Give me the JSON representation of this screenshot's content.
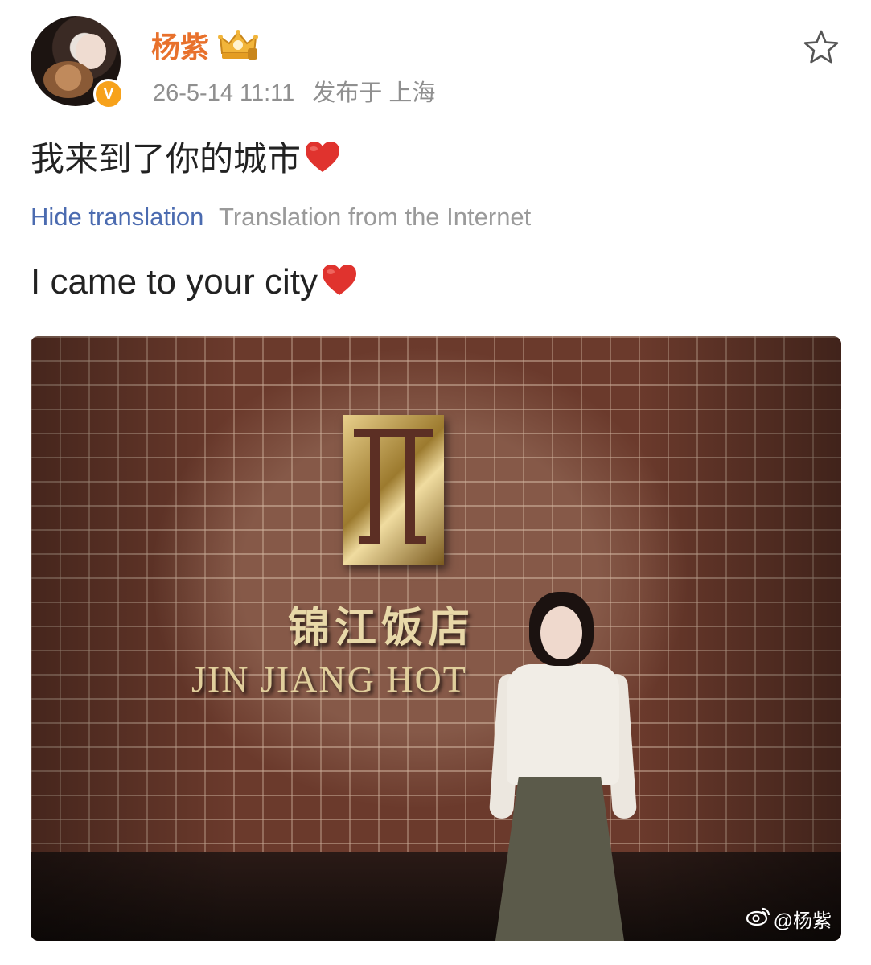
{
  "user": {
    "name": "杨紫",
    "verified_mark": "V"
  },
  "post": {
    "time": "26-5-14 11:11",
    "location": "发布于 上海",
    "text": "我来到了你的城市",
    "translation_toggle": "Hide translation",
    "translation_source": "Translation from the Internet",
    "translated_text": "I came to your city"
  },
  "photo": {
    "sign_cn": "锦江饭店",
    "sign_en": "JIN JIANG HOT",
    "watermark": "@杨紫"
  },
  "icons": {
    "favorite": "star-outline-icon",
    "emoji": "red-heart-icon",
    "member": "crown-icon"
  },
  "colors": {
    "username": "#e8712c",
    "link": "#4b6bb0",
    "meta": "#8f8f8f",
    "heart": "#e0332e"
  }
}
